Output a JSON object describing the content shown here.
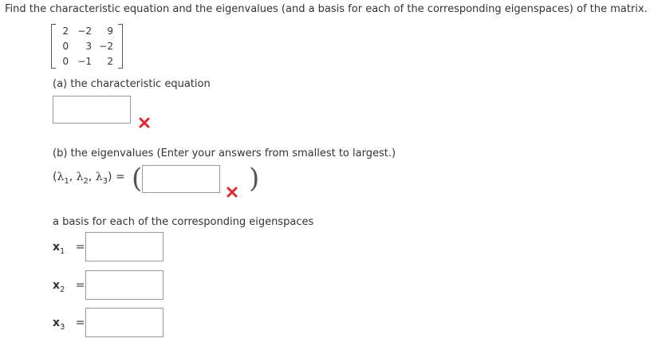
{
  "question": {
    "prompt": "Find the characteristic equation and the eigenvalues (and a basis for each of the corresponding eigenspaces) of the matrix."
  },
  "matrix": {
    "rows": [
      [
        "2",
        "−2",
        "9"
      ],
      [
        "0",
        "3",
        "−2"
      ],
      [
        "0",
        "−1",
        "2"
      ]
    ]
  },
  "part_a": {
    "label": "(a) the characteristic equation",
    "value": "",
    "status": "incorrect"
  },
  "part_b": {
    "label": "(b) the eigenvalues (Enter your answers from smallest to largest.)",
    "lhs_open": "(",
    "lambda": "λ",
    "sub1": "1",
    "sub2": "2",
    "sub3": "3",
    "comma": ",",
    "lhs_close": ")",
    "equals": "=",
    "value": "",
    "status": "incorrect"
  },
  "basis": {
    "label": "a basis for each of the corresponding eigenspaces",
    "items": [
      {
        "var": "x",
        "sub": "1",
        "equals": "=",
        "value": ""
      },
      {
        "var": "x",
        "sub": "2",
        "equals": "=",
        "value": ""
      },
      {
        "var": "x",
        "sub": "3",
        "equals": "=",
        "value": ""
      }
    ]
  },
  "colors": {
    "incorrect": "#e0282e",
    "text": "#333333",
    "border": "#9a9a9a"
  }
}
